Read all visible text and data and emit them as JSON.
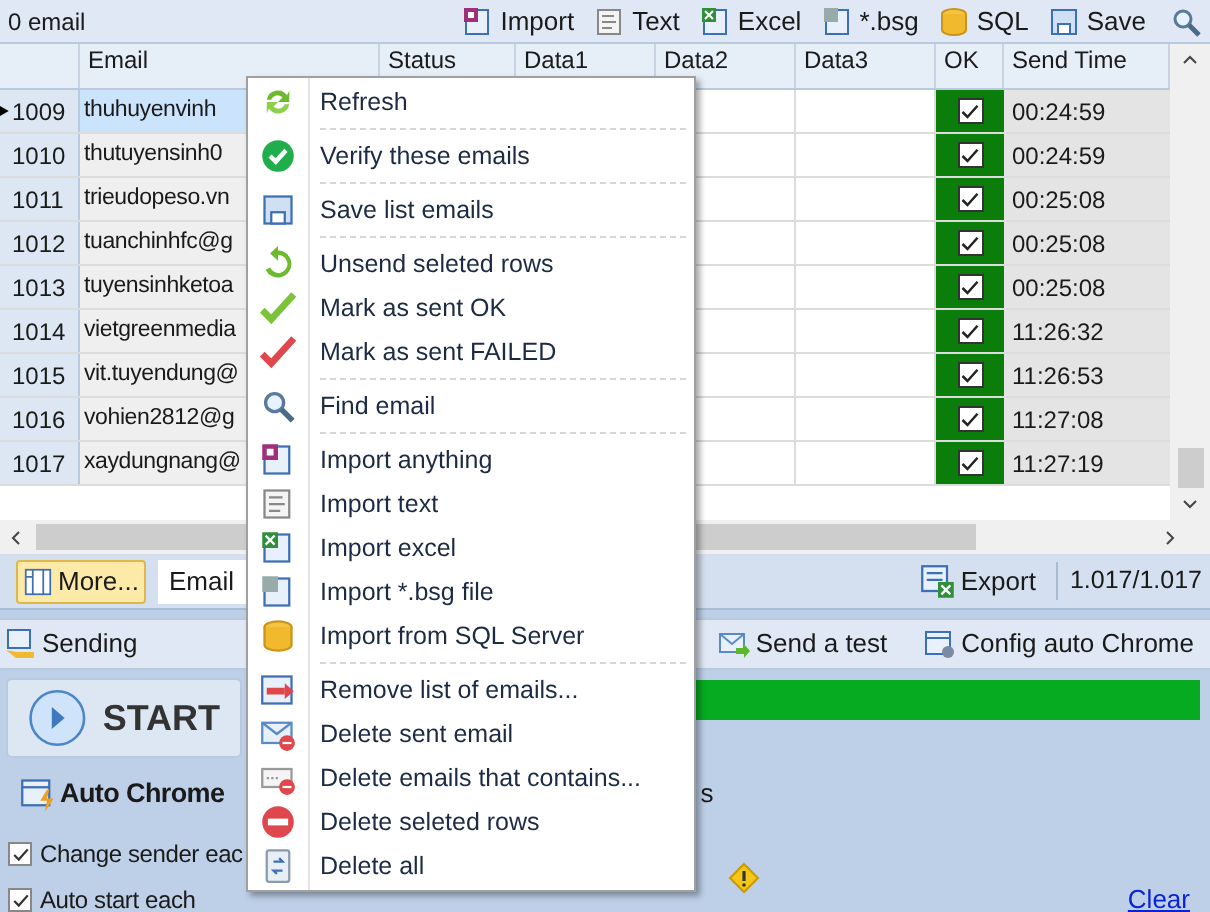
{
  "toolbar": {
    "count": "0 email",
    "buttons": [
      "Import",
      "Text",
      "Excel",
      "*.bsg",
      "SQL",
      "Save"
    ]
  },
  "grid": {
    "columns": [
      "Email",
      "Status",
      "Data1",
      "Data2",
      "Data3",
      "OK",
      "Send Time"
    ],
    "rows": [
      {
        "id": "1009",
        "email": "thuhuyenvinh",
        "ok": true,
        "time": "00:24:59",
        "selected": true
      },
      {
        "id": "1010",
        "email": "thutuyensinh0",
        "ok": true,
        "time": "00:24:59",
        "selected": false
      },
      {
        "id": "1011",
        "email": "trieudopeso.vn",
        "ok": true,
        "time": "00:25:08",
        "selected": false
      },
      {
        "id": "1012",
        "email": "tuanchinhfc@g",
        "ok": true,
        "time": "00:25:08",
        "selected": false
      },
      {
        "id": "1013",
        "email": "tuyensinhketoa",
        "ok": true,
        "time": "00:25:08",
        "selected": false
      },
      {
        "id": "1014",
        "email": "vietgreenmedia",
        "ok": true,
        "time": "11:26:32",
        "selected": false
      },
      {
        "id": "1015",
        "email": "vit.tuyendung@",
        "ok": true,
        "time": "11:26:53",
        "selected": false
      },
      {
        "id": "1016",
        "email": "vohien2812@g",
        "ok": true,
        "time": "11:27:08",
        "selected": false
      },
      {
        "id": "1017",
        "email": "xaydungnang@",
        "ok": true,
        "time": "11:27:19",
        "selected": false
      }
    ]
  },
  "grid_bar": {
    "more": "More...",
    "tab": "Email",
    "export": "Export",
    "counter": "1.017/1.017"
  },
  "sending_bar": {
    "title": "Sending",
    "buttons": [
      "Send a test",
      "Config auto Chrome"
    ]
  },
  "start": {
    "label": "START",
    "progress": {
      "level": 1
    }
  },
  "auto_chrome": {
    "label": "Auto Chrome",
    "fragment": "s"
  },
  "options": [
    {
      "label": "Change sender eac",
      "checked": true
    },
    {
      "label": "Auto start each",
      "checked": true
    }
  ],
  "clear_link": "Clear",
  "context_menu": [
    [
      "Refresh"
    ],
    [
      "Verify these emails"
    ],
    [
      "Save list emails"
    ],
    [
      "Unsend seleted rows",
      "Mark as sent OK",
      "Mark as sent FAILED"
    ],
    [
      "Find email"
    ],
    [
      "Import anything",
      "Import text",
      "Import excel",
      "Import *.bsg file",
      "Import from SQL Server"
    ],
    [
      "Remove list of emails...",
      "Delete sent email",
      "Delete emails that contains...",
      "Delete seleted rows",
      "Delete all"
    ]
  ]
}
